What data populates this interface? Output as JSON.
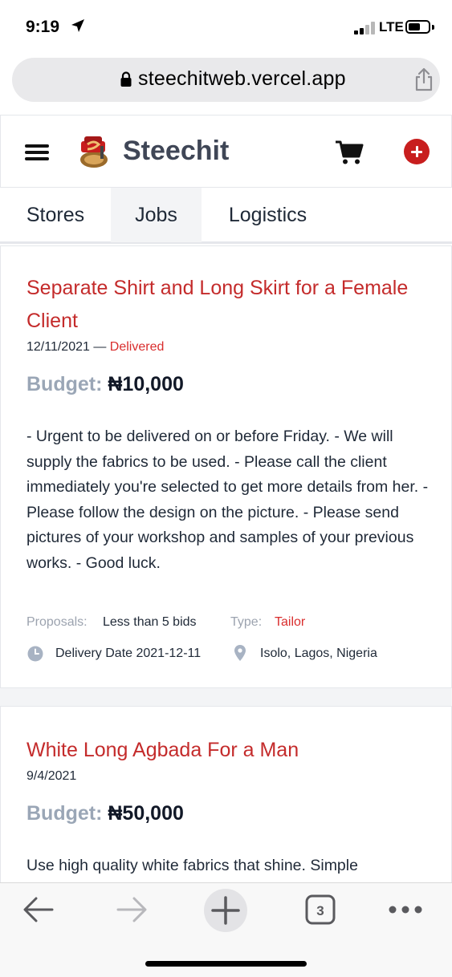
{
  "status_bar": {
    "time": "9:19",
    "network": "LTE"
  },
  "browser": {
    "url": "steechitweb.vercel.app",
    "tab_count": "3"
  },
  "header": {
    "brand": "Steechit",
    "colors": {
      "brand_text": "#3f4656",
      "accent": "#c81e1e"
    }
  },
  "tabs": [
    {
      "label": "Stores",
      "active": false
    },
    {
      "label": "Jobs",
      "active": true
    },
    {
      "label": "Logistics",
      "active": false
    }
  ],
  "jobs": [
    {
      "title": "Separate Shirt and Long Skirt for a Female Client",
      "date": "12/11/2021",
      "separator": "—",
      "status": "Delivered",
      "budget_label": "Budget:",
      "budget_value": "₦10,000",
      "description": "- Urgent to be delivered on or before Friday. - We will supply the fabrics to be used. - Please call the client immediately you're selected to get more details from her. - Please follow the design on the picture. - Please send pictures of your workshop and samples of your previous works. - Good luck.",
      "proposals_label": "Proposals:",
      "proposals_value": "Less than 5 bids",
      "type_label": "Type:",
      "type_value": "Tailor",
      "delivery_date": "Delivery Date 2021-12-11",
      "location": "Isolo, Lagos, Nigeria"
    },
    {
      "title": "White Long Agbada For a Man",
      "date": "9/4/2021",
      "budget_label": "Budget:",
      "budget_value": "₦50,000",
      "description": "Use high quality white fabrics that shine. Simple"
    }
  ]
}
